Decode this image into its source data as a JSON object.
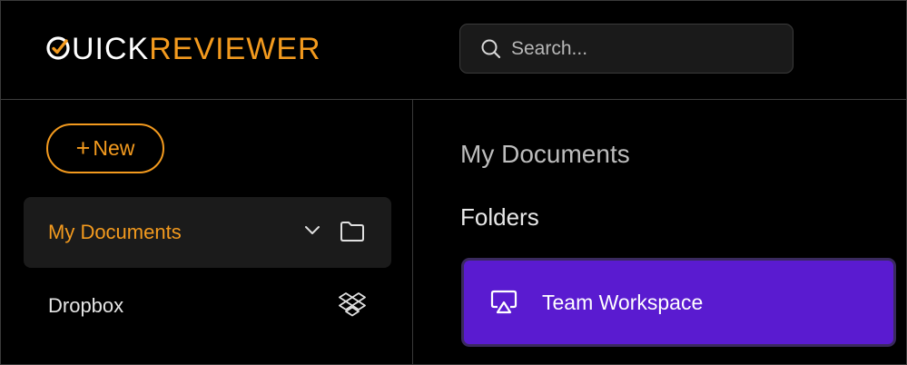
{
  "brand": {
    "logo_quick": "UICK",
    "logo_reviewer": "REVIEWER",
    "logo_q": "Q",
    "accent_color": "#f39a1e"
  },
  "search": {
    "placeholder": "Search...",
    "value": "",
    "icon": "search-icon"
  },
  "sidebar": {
    "new_button": {
      "plus": "+",
      "label": "New"
    },
    "items": [
      {
        "label": "My Documents",
        "icons": [
          "chevron-down-icon",
          "folder-icon"
        ],
        "active": true
      },
      {
        "label": "Dropbox",
        "icons": [
          "dropbox-icon"
        ],
        "active": false
      }
    ]
  },
  "main": {
    "title": "My Documents",
    "section_title": "Folders",
    "folders": [
      {
        "name": "Team Workspace",
        "icon": "shared-screen-icon",
        "color": "#5a1bd0"
      }
    ]
  }
}
